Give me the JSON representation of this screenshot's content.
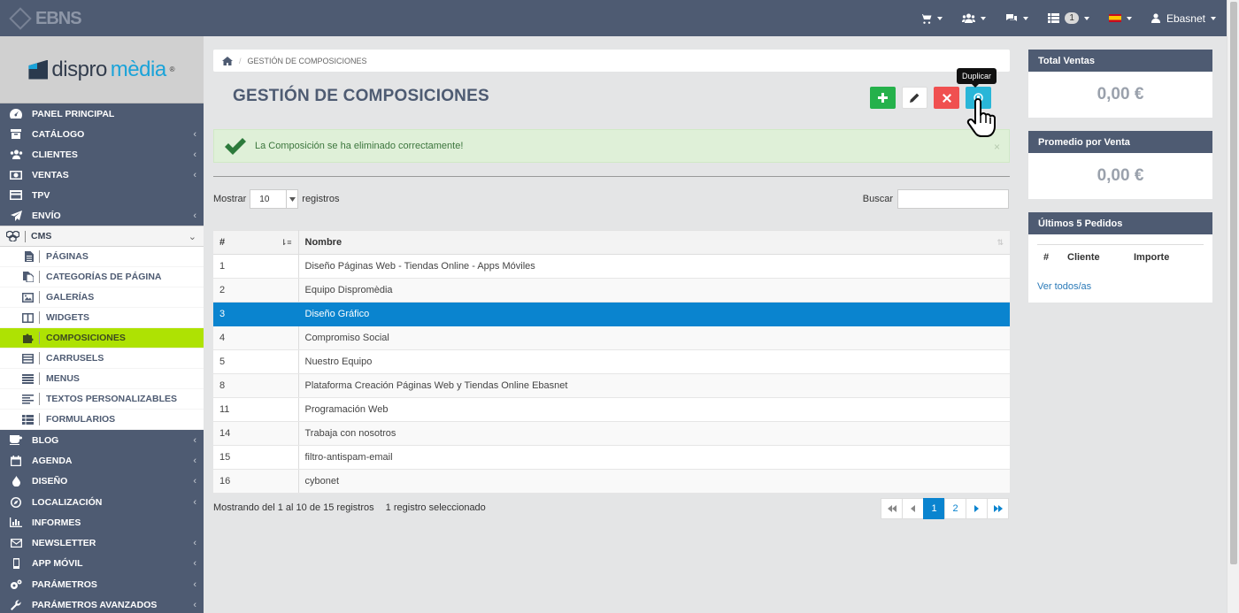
{
  "topbar": {
    "logo_text": "EBNS",
    "notifications_count": "1",
    "user_name": "Ebasnet"
  },
  "sidebar": {
    "brand": {
      "part1": "dispro",
      "part2": "mèdia",
      "reg": "®"
    },
    "items_top": [
      {
        "label": "PANEL PRINCIPAL",
        "icon": "dashboard-icon",
        "arrow": ""
      },
      {
        "label": "CATÁLOGO",
        "icon": "archive-icon",
        "arrow": "‹"
      },
      {
        "label": "CLIENTES",
        "icon": "users-icon",
        "arrow": "‹"
      },
      {
        "label": "VENTAS",
        "icon": "money-icon",
        "arrow": "‹"
      },
      {
        "label": "TPV",
        "icon": "credit-card-icon",
        "arrow": ""
      },
      {
        "label": "ENVÍO",
        "icon": "paper-plane-icon",
        "arrow": "‹"
      }
    ],
    "cms": {
      "label": "CMS",
      "arrow": "⌄"
    },
    "cms_items": [
      {
        "label": "PÁGINAS"
      },
      {
        "label": "CATEGORÍAS DE PÁGINA"
      },
      {
        "label": "GALERÍAS"
      },
      {
        "label": "WIDGETS"
      },
      {
        "label": "COMPOSICIONES"
      },
      {
        "label": "CARRUSELS"
      },
      {
        "label": "MENUS"
      },
      {
        "label": "TEXTOS PERSONALIZABLES"
      },
      {
        "label": "FORMULARIOS"
      }
    ],
    "items_bottom": [
      {
        "label": "BLOG",
        "arrow": "‹"
      },
      {
        "label": "AGENDA",
        "arrow": "‹"
      },
      {
        "label": "DISEÑO",
        "arrow": "‹"
      },
      {
        "label": "LOCALIZACIÓN",
        "arrow": "‹"
      },
      {
        "label": "INFORMES",
        "arrow": ""
      },
      {
        "label": "NEWSLETTER",
        "arrow": "‹"
      },
      {
        "label": "APP MÓVIL",
        "arrow": "‹"
      },
      {
        "label": "PARÁMETROS",
        "arrow": "‹"
      },
      {
        "label": "PARÁMETROS AVANZADOS",
        "arrow": "‹"
      }
    ]
  },
  "breadcrumb": {
    "current": "GESTIÓN DE COMPOSICIONES"
  },
  "page": {
    "title": "GESTIÓN DE COMPOSICIONES",
    "tooltip": "Duplicar"
  },
  "alert": {
    "message": "La Composición se ha eliminado correctamente!",
    "close": "×"
  },
  "table_controls": {
    "show_label": "Mostrar",
    "page_size": "10",
    "records_label": "registros",
    "search_label": "Buscar"
  },
  "table": {
    "columns": [
      "#",
      "Nombre"
    ],
    "rows": [
      {
        "id": "1",
        "name": "Diseño Páginas Web - Tiendas Online - Apps Móviles"
      },
      {
        "id": "2",
        "name": "Equipo Dispromèdia"
      },
      {
        "id": "3",
        "name": "Diseño Gráfico"
      },
      {
        "id": "4",
        "name": "Compromiso Social"
      },
      {
        "id": "5",
        "name": "Nuestro Equipo"
      },
      {
        "id": "8",
        "name": "Plataforma Creación Páginas Web y Tiendas Online Ebasnet"
      },
      {
        "id": "11",
        "name": "Programación Web"
      },
      {
        "id": "14",
        "name": "Trabaja con nosotros"
      },
      {
        "id": "15",
        "name": "filtro-antispam-email"
      },
      {
        "id": "16",
        "name": "cybonet"
      }
    ],
    "selected_index": 2
  },
  "footer": {
    "info": "Mostrando del 1 al 10 de 15 registros",
    "selected": "1 registro seleccionado",
    "pages": [
      "1",
      "2"
    ],
    "active_page": "1"
  },
  "panels": {
    "total_sales": {
      "title": "Total Ventas",
      "value": "0,00 €"
    },
    "avg_sale": {
      "title": "Promedio por Venta",
      "value": "0,00 €"
    },
    "last_orders": {
      "title": "Últimos 5 Pedidos",
      "columns": [
        "#",
        "Cliente",
        "Importe"
      ],
      "more_link": "Ver todos/as"
    }
  },
  "colors": {
    "topbar": "#4e5b72",
    "active_menu": "#aee203",
    "selected_row": "#0a84cf",
    "add_button": "#25b14b",
    "delete_button": "#f05050",
    "duplicate_button": "#29b6d8"
  }
}
